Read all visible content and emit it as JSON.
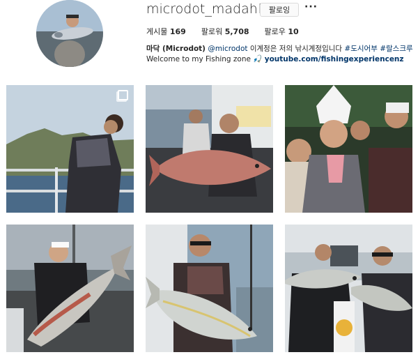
{
  "profile": {
    "username": "microdot_madahk",
    "follow_label": "팔로잉",
    "more_label": "···",
    "stats": {
      "posts_label": "게시물",
      "posts_value": "169",
      "followers_label": "팔로워",
      "followers_value": "5,708",
      "following_label": "팔로우",
      "following_value": "10"
    },
    "bio": {
      "name": "마닥 (Microdot)",
      "mention": "@microdot",
      "line1_text": " 이계정은 저의 낚시계정입니다 ",
      "hashtags": [
        "#도시어부",
        "#랄스크루"
      ],
      "line2_text": "Welcome to my Fishing zone 🎣 ",
      "link": "youtube.com/fishingexperiencenz"
    }
  },
  "posts": [
    {
      "subject": "man on boat deck facing island",
      "multi": true
    },
    {
      "subject": "two anglers holding red snapper",
      "multi": false
    },
    {
      "subject": "group selfie with chef hat",
      "multi": false
    },
    {
      "subject": "man holding large amberjack at pier",
      "multi": false
    },
    {
      "subject": "man in sunglasses holding yellowtail",
      "multi": false
    },
    {
      "subject": "two men holding fish on boat",
      "multi": false
    }
  ]
}
